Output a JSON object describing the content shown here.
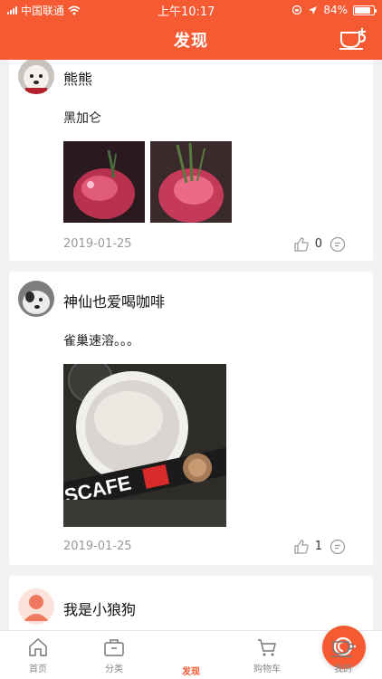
{
  "status_bar": {
    "carrier": "中国联通",
    "time": "上午10:17",
    "battery": "84%",
    "battery_level": 0.84
  },
  "nav": {
    "title": "发现"
  },
  "posts": [
    {
      "user": "熊熊",
      "text": "黑加仑",
      "date": "2019-01-25",
      "likes": "0"
    },
    {
      "user": "神仙也爱喝咖啡",
      "text": "雀巢速溶。。。",
      "date": "2019-01-25",
      "likes": "1",
      "photo_text": "SCAFE"
    },
    {
      "user": "我是小狼狗"
    }
  ],
  "tabs": [
    {
      "label": "首页",
      "icon": "home-icon"
    },
    {
      "label": "分类",
      "icon": "category-icon"
    },
    {
      "label": "发现",
      "icon": "discover-icon",
      "active": true
    },
    {
      "label": "购物车",
      "icon": "cart-icon"
    },
    {
      "label": "我的",
      "icon": "profile-cup-icon"
    }
  ],
  "colors": {
    "accent": "#f55a33"
  }
}
